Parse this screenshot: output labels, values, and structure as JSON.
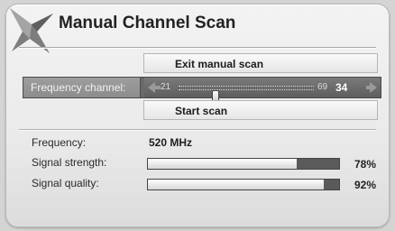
{
  "dialog": {
    "title": "Manual Channel Scan",
    "logo_icon": "star-logo-icon"
  },
  "buttons": {
    "exit_label": "Exit manual scan",
    "start_label": "Start scan"
  },
  "frequency_channel": {
    "label": "Frequency channel:",
    "min": "21",
    "max": "69",
    "current": "34",
    "min_value": 21,
    "max_value": 69,
    "current_value": 34,
    "left_icon": "arrow-left-icon",
    "right_icon": "arrow-right-icon"
  },
  "info": {
    "frequency_label": "Frequency:",
    "frequency_value": "520 MHz",
    "signal_strength_label": "Signal strength:",
    "signal_strength_value": "78%",
    "signal_strength_level": 78,
    "signal_quality_label": "Signal quality:",
    "signal_quality_value": "92%",
    "signal_quality_level": 92
  },
  "colors": {
    "panel": "#eaeaea",
    "selected_row": "#6a6a6a",
    "bar_empty": "#5a5a5a",
    "bar_fill": "#ffffff"
  }
}
